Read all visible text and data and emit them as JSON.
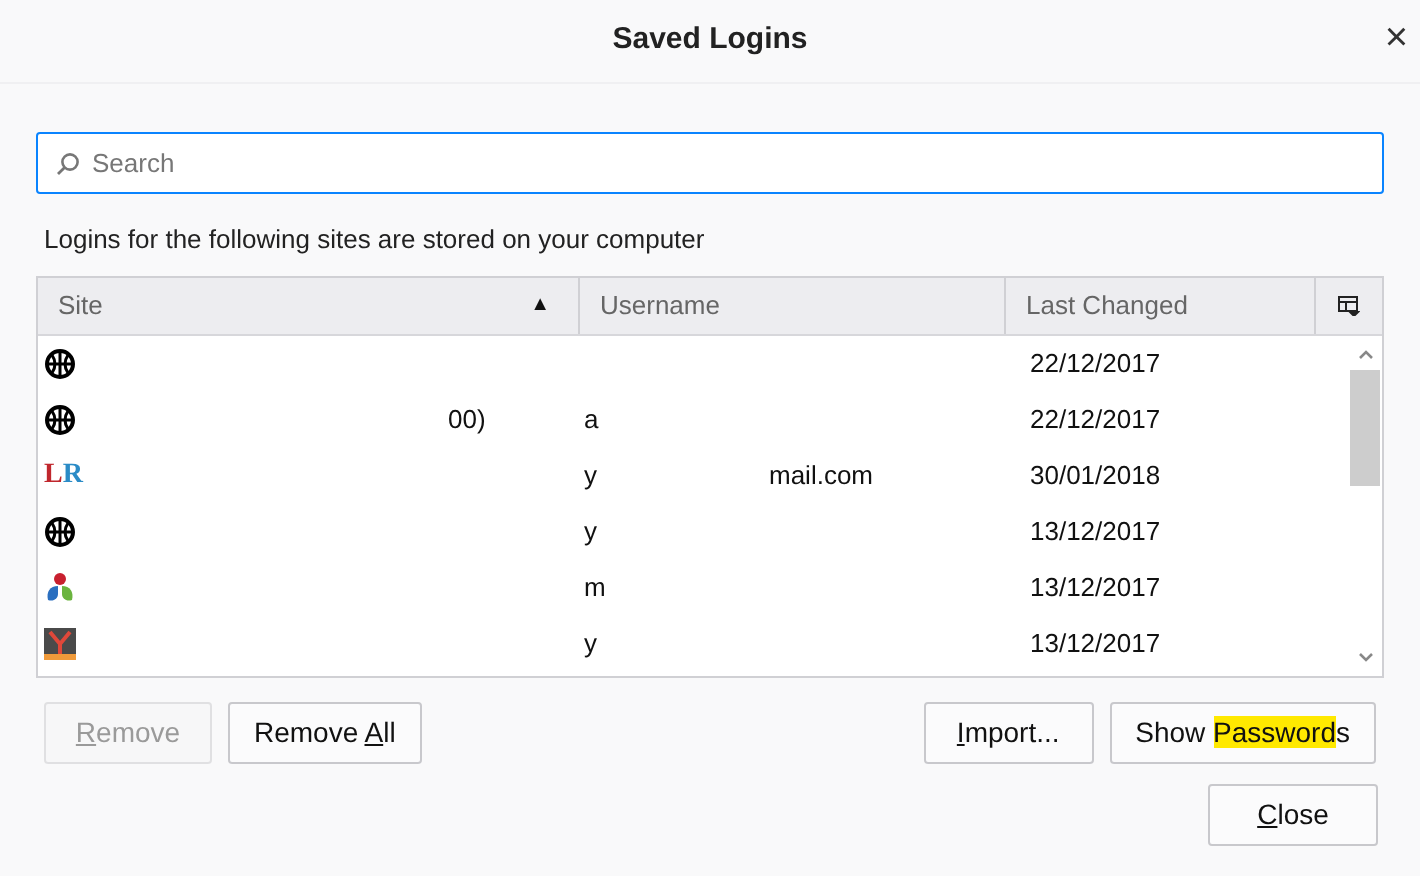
{
  "window": {
    "title": "Saved Logins",
    "close": "×"
  },
  "search": {
    "placeholder": "Search"
  },
  "description": "Logins for the following sites are stored on your computer",
  "table": {
    "columns": [
      {
        "label": "Site",
        "sort": "▲"
      },
      {
        "label": "Username"
      },
      {
        "label": "Last Changed"
      }
    ],
    "rows": [
      {
        "kind": "globe",
        "changed": "22/12/2017"
      },
      {
        "kind": "globe",
        "site": "00)",
        "username": "a",
        "changed": "22/12/2017"
      },
      {
        "kind": "letters",
        "icon_text": [
          "L",
          "R"
        ],
        "username": "y",
        "username_tail": "mail.com",
        "changed": "30/01/2018"
      },
      {
        "kind": "globe",
        "username": "y",
        "changed": "13/12/2017"
      },
      {
        "kind": "bubbles",
        "username": "m",
        "changed": "13/12/2017"
      },
      {
        "kind": "tile",
        "username": "y",
        "changed": "13/12/2017"
      }
    ]
  },
  "buttons_left": [
    {
      "key": "R",
      "after": "emove",
      "disabled": true
    },
    {
      "before": "Remove ",
      "key": "A",
      "after": "ll",
      "disabled": false
    }
  ],
  "buttons_right": [
    {
      "key": "I",
      "after": "mport...",
      "disabled": false
    },
    {
      "before": "Show ",
      "key": "Password",
      "after": "s",
      "highlight": true,
      "disabled": false
    }
  ],
  "close_button": {
    "key": "C",
    "after": "lose",
    "disabled": false
  }
}
